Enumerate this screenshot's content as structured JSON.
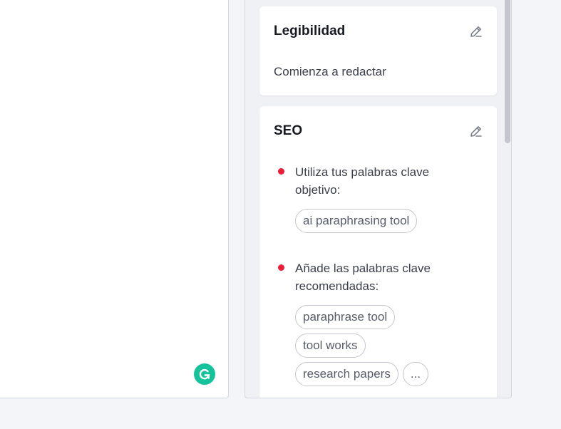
{
  "readability": {
    "title": "Legibilidad",
    "text": "Comienza a redactar"
  },
  "seo": {
    "title": "SEO",
    "items": [
      {
        "text": "Utiliza tus palabras clave objetivo:",
        "chips": [
          "ai paraphrasing tool"
        ]
      },
      {
        "text": "Añade las palabras clave recomendadas:",
        "chips": [
          "paraphrase tool",
          "tool works",
          "research papers",
          "..."
        ]
      }
    ]
  },
  "colors": {
    "bullet": "#ed1d3a",
    "grammarly": "#15c39a"
  },
  "icons": {
    "edit": "pencil-icon",
    "grammarly": "grammarly-g-icon"
  }
}
